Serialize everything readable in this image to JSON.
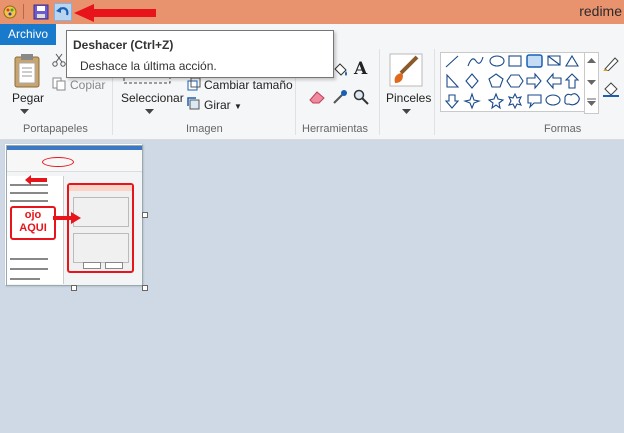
{
  "window": {
    "title": "redime"
  },
  "qat": {
    "icons": [
      "paint-app-icon",
      "save-icon",
      "undo-icon"
    ]
  },
  "tabs": {
    "archivo": "Archivo"
  },
  "ribbon": {
    "clipboard": {
      "paste": "Pegar",
      "copy": "Copiar",
      "label": "Portapapeles"
    },
    "image": {
      "select": "Seleccionar",
      "resize": "Cambiar tamaño",
      "rotate": "Girar",
      "label": "Imagen"
    },
    "tools": {
      "label": "Herramientas"
    },
    "brushes": {
      "label": "Pinceles"
    },
    "shapes": {
      "label": "Formas"
    }
  },
  "tooltip": {
    "title": "Deshacer (Ctrl+Z)",
    "description": "Deshace la última acción."
  },
  "annotation": {
    "line1": "ojo",
    "line2": "AQUI"
  },
  "colors": {
    "title_bar": "#e8926e",
    "accent": "#1979ca",
    "annotation_red": "#e8141b",
    "canvas_bg": "#cfd9e6"
  }
}
